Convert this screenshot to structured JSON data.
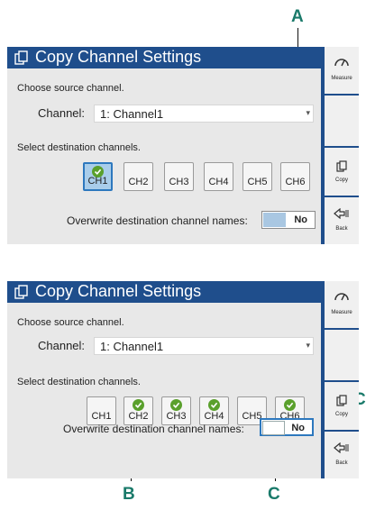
{
  "callouts": {
    "a": "A",
    "b": "B",
    "c": "C"
  },
  "screen_top": {
    "title": "Copy Channel Settings",
    "source_prompt": "Choose source channel.",
    "channel_label": "Channel:",
    "channel_value": "1: Channel1",
    "dest_prompt": "Select destination channels.",
    "channels": [
      {
        "label": "CH1",
        "checked": true,
        "source": true
      },
      {
        "label": "CH2",
        "checked": false
      },
      {
        "label": "CH3",
        "checked": false
      },
      {
        "label": "CH4",
        "checked": false
      },
      {
        "label": "CH5",
        "checked": false
      },
      {
        "label": "CH6",
        "checked": false
      }
    ],
    "overwrite_label": "Overwrite destination channel names:",
    "overwrite_state": "No"
  },
  "screen_bottom": {
    "title": "Copy Channel Settings",
    "source_prompt": "Choose source channel.",
    "channel_label": "Channel:",
    "channel_value": "1: Channel1",
    "dest_prompt": "Select destination channels.",
    "channels": [
      {
        "label": "CH1",
        "checked": false
      },
      {
        "label": "CH2",
        "checked": true
      },
      {
        "label": "CH3",
        "checked": true
      },
      {
        "label": "CH4",
        "checked": true
      },
      {
        "label": "CH5",
        "checked": false
      },
      {
        "label": "CH6",
        "checked": true
      }
    ],
    "overwrite_label": "Overwrite destination channel names:",
    "overwrite_state": "No"
  },
  "sidebar": {
    "measure": "Measure",
    "copy": "Copy",
    "back": "Back"
  },
  "colors": {
    "title_bar": "#1f4e8c",
    "check": "#5aa02c",
    "selected": "#a9cdea",
    "callout": "#1a7a6a"
  }
}
